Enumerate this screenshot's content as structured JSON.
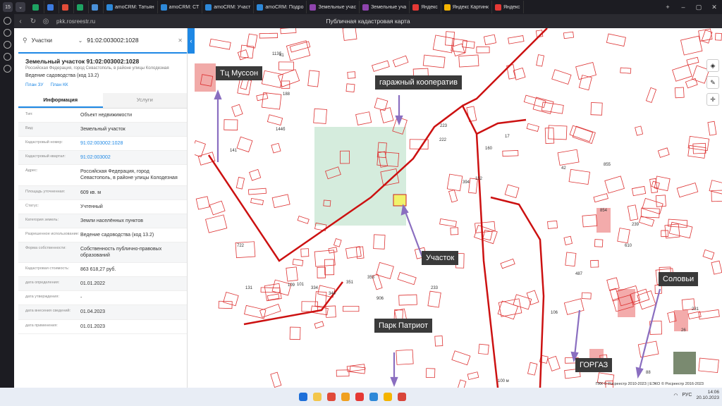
{
  "browser": {
    "tab_count": "15",
    "tabs": [
      {
        "label": "",
        "color": "#1ea362"
      },
      {
        "label": "",
        "color": "#3c7be0"
      },
      {
        "label": "",
        "color": "#e14c38"
      },
      {
        "label": "",
        "color": "#1ea362"
      },
      {
        "label": "",
        "color": "#4a90d9"
      },
      {
        "label": "amoCRM: Татьян",
        "color": "#2d88d8"
      },
      {
        "label": "amoCRM: СТ",
        "color": "#2d88d8"
      },
      {
        "label": "amoCRM: Участ",
        "color": "#2d88d8"
      },
      {
        "label": "amoCRM: Подро",
        "color": "#2d88d8"
      },
      {
        "label": "Земельные учас",
        "color": "#8e44ad"
      },
      {
        "label": "Земельные уча",
        "color": "#8e44ad"
      },
      {
        "label": "Яндекс",
        "color": "#e53935"
      },
      {
        "label": "Яндекс Картинк",
        "color": "#f4b400"
      },
      {
        "label": "Яндекс",
        "color": "#e53935"
      }
    ],
    "url": "pkk.rosreestr.ru",
    "page_title": "Публичная кадастровая карта"
  },
  "panel": {
    "search_type": "Участки",
    "search_value": "91:02:003002:1028",
    "title": "Земельный участок 91:02:003002:1028",
    "address": "Российская Федерация, город Севастополь, в районе улицы Колодезная",
    "usage": "Ведение садоводства (код 13.2)",
    "link_plan_zu": "План ЗУ",
    "link_plan_kk": "План КК",
    "tab_info": "Информация",
    "tab_services": "Услуги",
    "rows": [
      {
        "label": "Тип:",
        "value": "Объект недвижимости"
      },
      {
        "label": "Вид:",
        "value": "Земельный участок"
      },
      {
        "label": "Кадастровый номер:",
        "value": "91:02:003002:1028"
      },
      {
        "label": "Кадастровый квартал:",
        "value": "91:02:003002"
      },
      {
        "label": "Адрес:",
        "value": "Российская Федерация, город Севастополь, в районе улицы Колодезная"
      },
      {
        "label": "Площадь уточненная:",
        "value": "609 кв. м"
      },
      {
        "label": "Статус:",
        "value": "Учтенный"
      },
      {
        "label": "Категория земель:",
        "value": "Земли населённых пунктов"
      },
      {
        "label": "Разрешенное использование:",
        "value": "Ведение садоводства (код 13.2)"
      },
      {
        "label": "Форма собственности:",
        "value": "Собственность публично-правовых образований"
      },
      {
        "label": "Кадастровая стоимость:",
        "value": "863 618,27 руб."
      },
      {
        "label": "дата определения:",
        "value": "01.01.2022"
      },
      {
        "label": "дата утверждения:",
        "value": "-"
      },
      {
        "label": "дата внесения сведений:",
        "value": "01.04.2023"
      },
      {
        "label": "дата применения:",
        "value": "01.01.2023"
      }
    ]
  },
  "map": {
    "annotations": {
      "tc": "Тц   Муссон",
      "garage": "гаражный кооператив",
      "plot": "Участок",
      "park": "Парк  Патриот",
      "gorgaz": "ГОРГАЗ",
      "solovi": "Соловьи"
    },
    "scale": "100 м",
    "copyright": "ПКК © Росреестр 2010-2023 | ЕЭКО © Росреестр 2016-2023",
    "labels": [
      "41",
      "113б",
      "188",
      "141",
      "144б",
      "722",
      "131",
      "906",
      "233",
      "17",
      "160",
      "42",
      "855",
      "854",
      "239",
      "610",
      "487",
      "106",
      "231",
      "26",
      "88",
      "223",
      "222",
      "152",
      "394",
      "353",
      "351",
      "344",
      "334",
      "101",
      "109"
    ]
  },
  "taskbar": {
    "lang": "РУС",
    "time": "14:06",
    "date": "20.10.2023"
  }
}
